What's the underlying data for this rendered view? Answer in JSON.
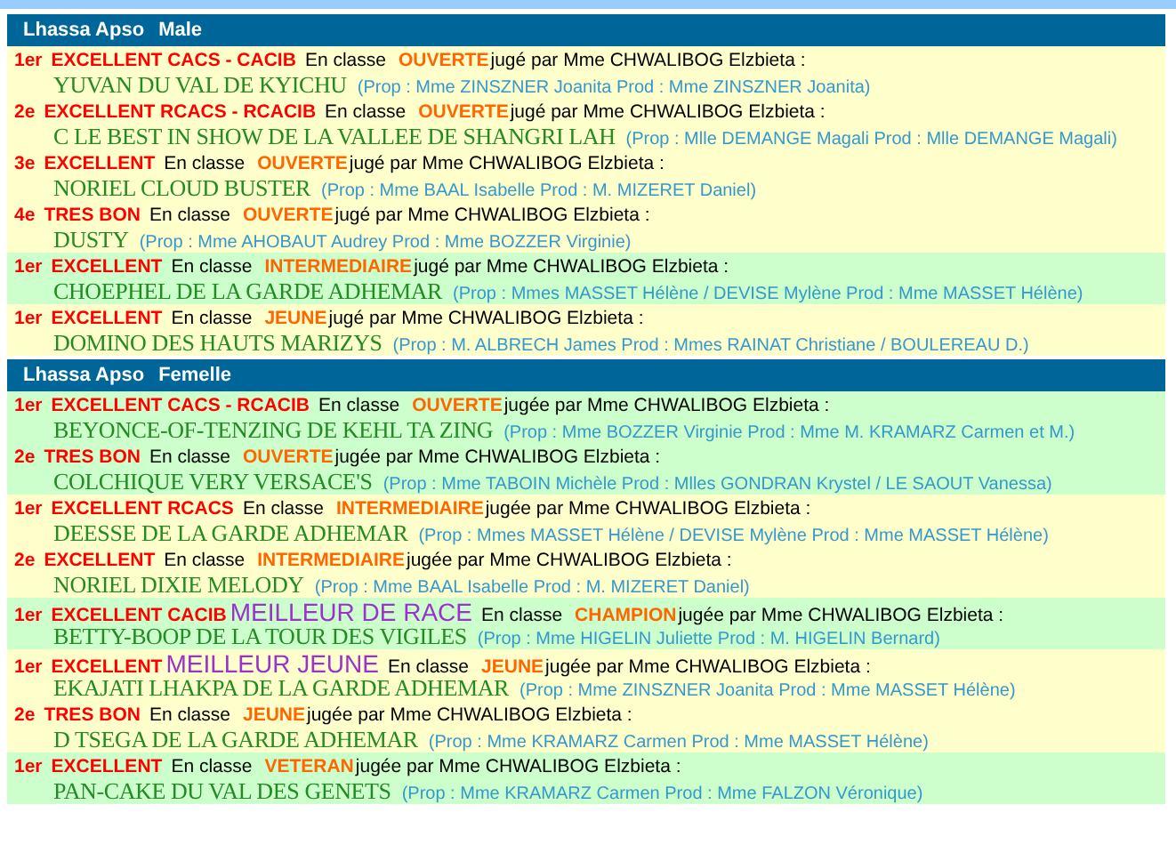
{
  "sections": [
    {
      "breed": "Lhassa Apso",
      "sex": "Male",
      "entries": [
        {
          "rank": "1er",
          "grade": "EXCELLENT CACS - CACIB",
          "class_label": "En classe",
          "class": "OUVERTE",
          "judge": "jugé par Mme CHWALIBOG Elzbieta :",
          "name": "YUVAN DU VAL DE KYICHU",
          "owners": "(Prop : Mme ZINSZNER Joanita  Prod : Mme ZINSZNER Joanita)",
          "highlighted": false
        },
        {
          "rank": "2e",
          "grade": "EXCELLENT RCACS - RCACIB",
          "class_label": "En classe",
          "class": "OUVERTE",
          "judge": "jugé par Mme CHWALIBOG Elzbieta :",
          "name": "C LE BEST IN SHOW DE LA VALLEE DE SHANGRI LAH",
          "owners": "(Prop : Mlle DEMANGE Magali  Prod : Mlle DEMANGE Magali)",
          "highlighted": false
        },
        {
          "rank": "3e",
          "grade": "EXCELLENT",
          "class_label": "En classe",
          "class": "OUVERTE",
          "judge": "jugé par Mme CHWALIBOG Elzbieta :",
          "name": "NORIEL CLOUD BUSTER",
          "owners": "(Prop : Mme BAAL Isabelle  Prod : M. MIZERET Daniel)",
          "highlighted": false
        },
        {
          "rank": "4e",
          "grade": "TRES BON",
          "class_label": "En classe",
          "class": "OUVERTE",
          "judge": "jugé par Mme CHWALIBOG Elzbieta :",
          "name": "DUSTY",
          "owners": "(Prop : Mme AHOBAUT Audrey  Prod : Mme BOZZER Virginie)",
          "highlighted": false
        },
        {
          "rank": "1er",
          "grade": "EXCELLENT",
          "class_label": "En classe",
          "class": "INTERMEDIAIRE",
          "judge": "jugé par Mme CHWALIBOG Elzbieta :",
          "name": "CHOEPHEL DE LA GARDE ADHEMAR",
          "owners": "(Prop : Mmes MASSET Hélène / DEVISE Mylène  Prod : Mme MASSET Hélène)",
          "highlighted": true
        },
        {
          "rank": "1er",
          "grade": "EXCELLENT",
          "class_label": "En classe",
          "class": "JEUNE",
          "judge": "jugé par Mme CHWALIBOG Elzbieta :",
          "name": "DOMINO DES HAUTS MARIZYS",
          "owners": "(Prop : M. ALBRECH James  Prod : Mmes RAINAT Christiane / BOULEREAU D.)",
          "highlighted": false
        }
      ]
    },
    {
      "breed": "Lhassa Apso",
      "sex": "Femelle",
      "entries": [
        {
          "rank": "1er",
          "grade": "EXCELLENT CACS - RCACIB",
          "class_label": "En classe",
          "class": "OUVERTE",
          "judge": "jugée par Mme CHWALIBOG Elzbieta :",
          "name": "BEYONCE-OF-TENZING DE KEHL TA ZING",
          "owners": "(Prop : Mme BOZZER Virginie  Prod : Mme M. KRAMARZ Carmen et M.)",
          "highlighted": true
        },
        {
          "rank": "2e",
          "grade": "TRES BON",
          "class_label": "En classe",
          "class": "OUVERTE",
          "judge": "jugée par Mme CHWALIBOG Elzbieta :",
          "name": "COLCHIQUE VERY VERSACE'S",
          "owners": "(Prop : Mme TABOIN Michèle  Prod : Mlles GONDRAN Krystel / LE SAOUT Vanessa)",
          "highlighted": true
        },
        {
          "rank": "1er",
          "grade": "EXCELLENT RCACS",
          "class_label": "En classe",
          "class": "INTERMEDIAIRE",
          "judge": "jugée par Mme CHWALIBOG Elzbieta :",
          "name": "DEESSE DE LA GARDE ADHEMAR",
          "owners": "(Prop : Mmes MASSET Hélène / DEVISE Mylène  Prod : Mme MASSET Hélène)",
          "highlighted": false
        },
        {
          "rank": "2e",
          "grade": "EXCELLENT",
          "class_label": "En classe",
          "class": "INTERMEDIAIRE",
          "judge": "jugée par Mme CHWALIBOG Elzbieta :",
          "name": "NORIEL DIXIE MELODY",
          "owners": "(Prop : Mme BAAL Isabelle  Prod : M. MIZERET Daniel)",
          "highlighted": false
        },
        {
          "rank": "1er",
          "grade": "EXCELLENT CACIB",
          "award": "MEILLEUR DE RACE",
          "class_label": "En classe",
          "class": "CHAMPION",
          "judge": "jugée par Mme CHWALIBOG Elzbieta :",
          "name": "BETTY-BOOP DE LA TOUR DES VIGILES",
          "owners": "(Prop : Mme HIGELIN Juliette  Prod : M. HIGELIN Bernard)",
          "highlighted": true
        },
        {
          "rank": "1er",
          "grade": "EXCELLENT",
          "award": "MEILLEUR JEUNE",
          "class_label": "En classe",
          "class": "JEUNE",
          "judge": "jugée par Mme CHWALIBOG Elzbieta :",
          "name": "EKAJATI LHAKPA DE LA GARDE ADHEMAR",
          "owners": "(Prop : Mme ZINSZNER Joanita  Prod : Mme MASSET Hélène)",
          "highlighted": false
        },
        {
          "rank": "2e",
          "grade": "TRES BON",
          "class_label": "En classe",
          "class": "JEUNE",
          "judge": "jugée par Mme CHWALIBOG Elzbieta :",
          "name": "D TSEGA DE LA GARDE ADHEMAR",
          "owners": "(Prop : Mme KRAMARZ Carmen  Prod : Mme MASSET Hélène)",
          "highlighted": false
        },
        {
          "rank": "1er",
          "grade": "EXCELLENT",
          "class_label": "En classe",
          "class": "VETERAN",
          "judge": "jugée par Mme CHWALIBOG Elzbieta :",
          "name": "PAN-CAKE DU VAL DES GENETS",
          "owners": "(Prop : Mme KRAMARZ Carmen  Prod : Mme FALZON Véronique)",
          "highlighted": true
        }
      ]
    }
  ]
}
